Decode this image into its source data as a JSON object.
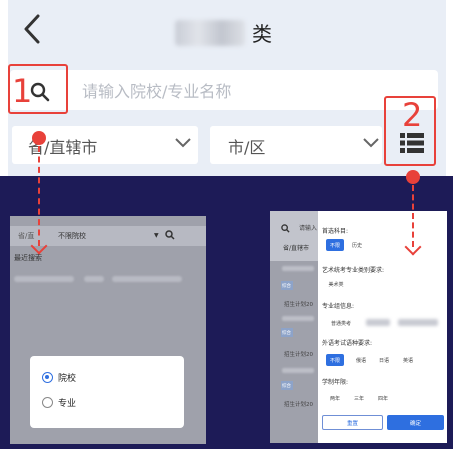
{
  "header": {
    "title_suffix": "类",
    "back_icon": "chevron-left-icon"
  },
  "search": {
    "placeholder": "请输入院校/专业名称",
    "icon": "search-icon"
  },
  "filters": {
    "province_label": "省/直辖市",
    "city_label": "市/区",
    "list_icon": "list-icon"
  },
  "callouts": {
    "one": "1",
    "two": "2",
    "color": "#e8413a"
  },
  "left_preview": {
    "province": "省/直",
    "filter": "不限院校",
    "caret": "▼",
    "recent": "最近搜索",
    "options": [
      "院校",
      "专业"
    ],
    "selected": "院校"
  },
  "right_preview": {
    "search_text": "请输入",
    "province": "省/直辖市",
    "badge": "综合",
    "plan_text": "招生计划20",
    "sections": [
      {
        "label": "首选科目:",
        "chips": [
          "不限",
          "历史"
        ]
      },
      {
        "label": "艺术统考专业类别要求:",
        "chips": [
          "美术类"
        ]
      },
      {
        "label": "专业组信息:",
        "chips": [
          "普通类考"
        ]
      },
      {
        "label": "外语考试语种要求:",
        "chips": [
          "不限",
          "俄语",
          "日语",
          "英语"
        ]
      },
      {
        "label": "学制年限:",
        "chips": [
          "两年",
          "三年",
          "四年"
        ]
      }
    ],
    "reset": "重置",
    "confirm": "确定"
  },
  "colors": {
    "accent": "#2e6fe0",
    "navy": "#1d1b57",
    "red": "#e8413a",
    "top_bg": "#e9eef6"
  }
}
